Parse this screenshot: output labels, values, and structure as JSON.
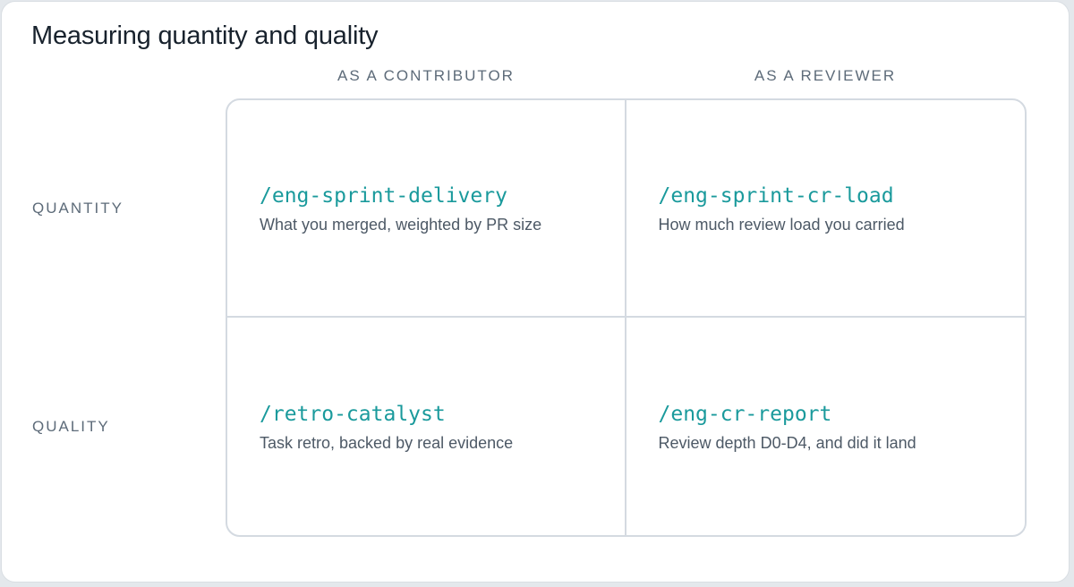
{
  "title": "Measuring quantity and quality",
  "columns": [
    "As a contributor",
    "As a reviewer"
  ],
  "rows": [
    "Quantity",
    "Quality"
  ],
  "cells": [
    {
      "command": "/eng-sprint-delivery",
      "description": "What you merged, weighted by PR size"
    },
    {
      "command": "/eng-sprint-cr-load",
      "description": "How much review load you carried"
    },
    {
      "command": "/retro-catalyst",
      "description": "Task retro, backed by real evidence"
    },
    {
      "command": "/eng-cr-report",
      "description": "Review depth D0-D4, and did it land"
    }
  ],
  "colors": {
    "command_accent": "#1a9a9c",
    "title": "#18222d",
    "muted_label": "#5d6b79",
    "border": "#d4dae1"
  }
}
